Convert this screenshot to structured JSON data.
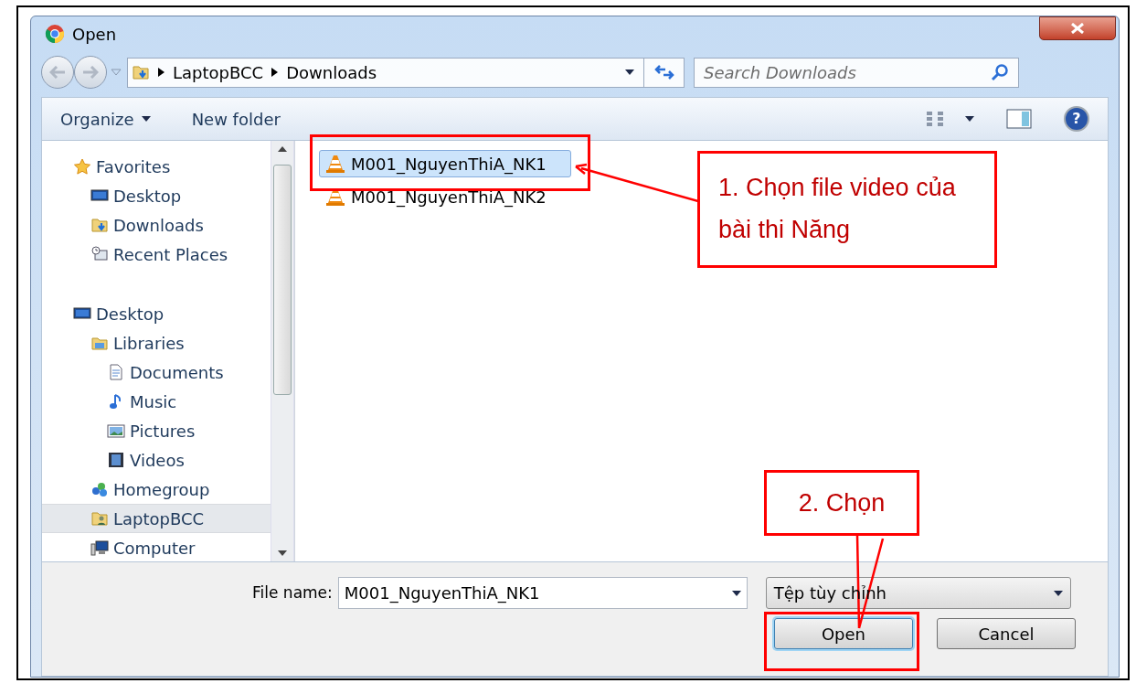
{
  "window": {
    "title": "Open"
  },
  "address": {
    "path": [
      "LaptopBCC",
      "Downloads"
    ]
  },
  "search": {
    "placeholder": "Search Downloads"
  },
  "help": {
    "glyph": "?"
  },
  "toolbar": {
    "buttons": [
      {
        "label": "Organize",
        "dropdown": true
      },
      {
        "label": "New folder",
        "dropdown": false
      }
    ]
  },
  "sidebar": {
    "items": [
      {
        "label": "Favorites",
        "kind": "star",
        "selected": false,
        "children": [
          {
            "label": "Desktop",
            "kind": "desktop",
            "selected": false
          },
          {
            "label": "Downloads",
            "kind": "downloads",
            "selected": false
          },
          {
            "label": "Recent Places",
            "kind": "recent",
            "selected": false
          }
        ]
      },
      {
        "label": "Desktop",
        "kind": "desktop",
        "selected": false,
        "children": [
          {
            "label": "Libraries",
            "kind": "library",
            "selected": false,
            "children": [
              {
                "label": "Documents",
                "kind": "document",
                "selected": false
              },
              {
                "label": "Music",
                "kind": "music",
                "selected": false
              },
              {
                "label": "Pictures",
                "kind": "picture",
                "selected": false
              },
              {
                "label": "Videos",
                "kind": "video",
                "selected": false
              }
            ]
          },
          {
            "label": "Homegroup",
            "kind": "homegroup",
            "selected": false
          },
          {
            "label": "LaptopBCC",
            "kind": "user",
            "selected": true
          },
          {
            "label": "Computer",
            "kind": "computer",
            "selected": false
          }
        ]
      }
    ]
  },
  "files": [
    {
      "name": "M001_NguyenThiA_NK1",
      "selected": true
    },
    {
      "name": "M001_NguyenThiA_NK2",
      "selected": false
    }
  ],
  "file_name": {
    "label": "File name:",
    "value": "M001_NguyenThiA_NK1"
  },
  "file_type": {
    "value": "Tệp tùy chỉnh"
  },
  "buttons": [
    {
      "label": "Open",
      "default": true
    },
    {
      "label": "Cancel",
      "default": false
    }
  ],
  "annotations": [
    {
      "text": "1. Chọn file video của bài thi Năng"
    },
    {
      "text": "2. Chọn"
    }
  ]
}
